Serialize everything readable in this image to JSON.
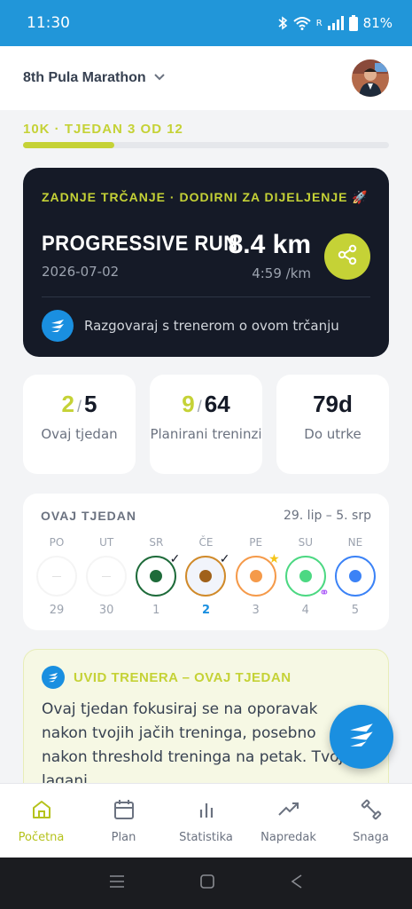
{
  "status_bar": {
    "time": "11:30",
    "network": "R",
    "battery": "81%"
  },
  "header": {
    "race_name": "8th Pula Marathon"
  },
  "plan": {
    "label": "10K · TJEDAN 3 OD 12",
    "progress": 0.25
  },
  "last_run": {
    "label": "ZADNJE TRČANJE · DODIRNI ZA DIJELJENJE 🚀",
    "title": "PROGRESSIVE RUN",
    "date": "2026-07-02",
    "distance": "8.4 km",
    "pace": "4:59 /km",
    "coach_chat": "Razgovaraj s trenerom o ovom trčanju"
  },
  "stats": [
    {
      "accent": "2",
      "sep": "/",
      "value": "5",
      "label": "Ovaj tjedan"
    },
    {
      "accent": "9",
      "sep": "/",
      "value": "64",
      "label": "Planirani treninzi"
    },
    {
      "accent": "",
      "sep": "",
      "value": "79d",
      "label": "Do utrke"
    }
  ],
  "week": {
    "title": "OVAJ TJEDAN",
    "range": "29. lip – 5. srp",
    "days": [
      {
        "name": "PO",
        "num": "29",
        "state": "rest"
      },
      {
        "name": "UT",
        "num": "30",
        "state": "rest"
      },
      {
        "name": "SR",
        "num": "1",
        "state": "done",
        "color": "#1e6b3a",
        "ring": "#1e6b3a",
        "mark": "✓"
      },
      {
        "name": "ČE",
        "num": "2",
        "state": "done-today",
        "color": "#a0611a",
        "ring": "#d08a2a",
        "mark": "✓"
      },
      {
        "name": "PE",
        "num": "3",
        "state": "planned",
        "color": "#f59a4a",
        "ring": "#f59a4a",
        "mark": "★"
      },
      {
        "name": "SU",
        "num": "4",
        "state": "planned",
        "color": "#4cd882",
        "ring": "#4cd882",
        "mark": "⚭"
      },
      {
        "name": "NE",
        "num": "5",
        "state": "planned",
        "color": "#3b82f6",
        "ring": "#3b82f6",
        "mark": ""
      }
    ]
  },
  "insight": {
    "title": "UVID TRENERA – OVAJ TJEDAN",
    "text": "Ovaj tjedan fokusiraj se na oporavak nakon tvojih jačih treninga, posebno nakon threshold treninga na petak. Tvoj lagani"
  },
  "nav": [
    {
      "label": "Početna",
      "icon": "home-icon",
      "active": true
    },
    {
      "label": "Plan",
      "icon": "calendar-icon",
      "active": false
    },
    {
      "label": "Statistika",
      "icon": "bar-chart-icon",
      "active": false
    },
    {
      "label": "Napredak",
      "icon": "trend-up-icon",
      "active": false
    },
    {
      "label": "Snaga",
      "icon": "dumbbell-icon",
      "active": false
    }
  ],
  "colors": {
    "accent": "#c5d236",
    "brand_blue": "#1a8fe0",
    "dark_card": "#151a27",
    "status_bar": "#2196d9"
  }
}
